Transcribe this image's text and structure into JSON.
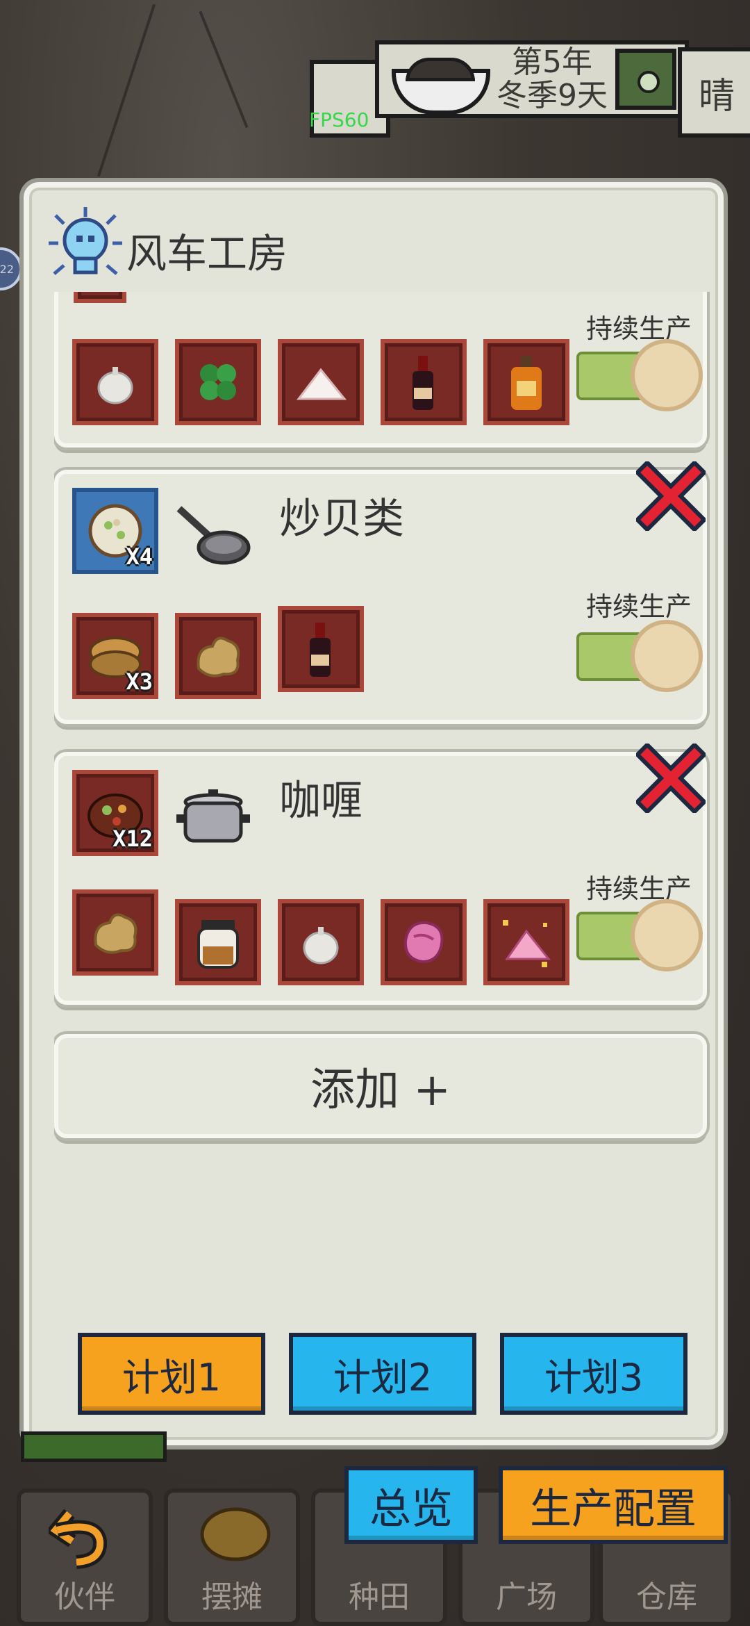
{
  "hud": {
    "date_line1": "第5年",
    "date_line2": "冬季9天",
    "weather": "晴",
    "fps": "FPS60",
    "side_badge": "22"
  },
  "panel": {
    "title": "风车工房",
    "continue_label": "持续生产",
    "add_label": "添加 +",
    "recipes": [
      {
        "name": "",
        "ingredients": [
          "garlic-icon",
          "clover-icon",
          "salt-icon",
          "wine-bottle-icon",
          "liquor-bottle-icon"
        ],
        "toggle_on": true
      },
      {
        "name": "炒贝类",
        "output_qty": "X4",
        "tool": "frying-pan-icon",
        "ingredients": [
          {
            "icon": "clam-icon",
            "qty": "X3"
          },
          {
            "icon": "ginger-icon",
            "qty": ""
          },
          {
            "icon": "wine-bottle-icon",
            "qty": ""
          }
        ],
        "toggle_on": true
      },
      {
        "name": "咖喱",
        "output_qty": "X12",
        "tool": "cooking-pot-icon",
        "ingredients": [
          "ginger-icon",
          "jar-icon",
          "garlic-icon",
          "meat-icon",
          "sparkling-salt-icon"
        ],
        "toggle_on": true
      }
    ],
    "plans": [
      "计划1",
      "计划2",
      "计划3"
    ]
  },
  "overlay": {
    "overview": "总览",
    "production_config": "生产配置"
  },
  "nav": [
    "伙伴",
    "摆摊",
    "种田",
    "广场",
    "仓库"
  ],
  "colors": {
    "orange": "#f7a21f",
    "blue": "#26b5ec",
    "slot": "#7a2a24",
    "toggle_green": "#a8c86a",
    "panel": "#e3e4d9"
  }
}
